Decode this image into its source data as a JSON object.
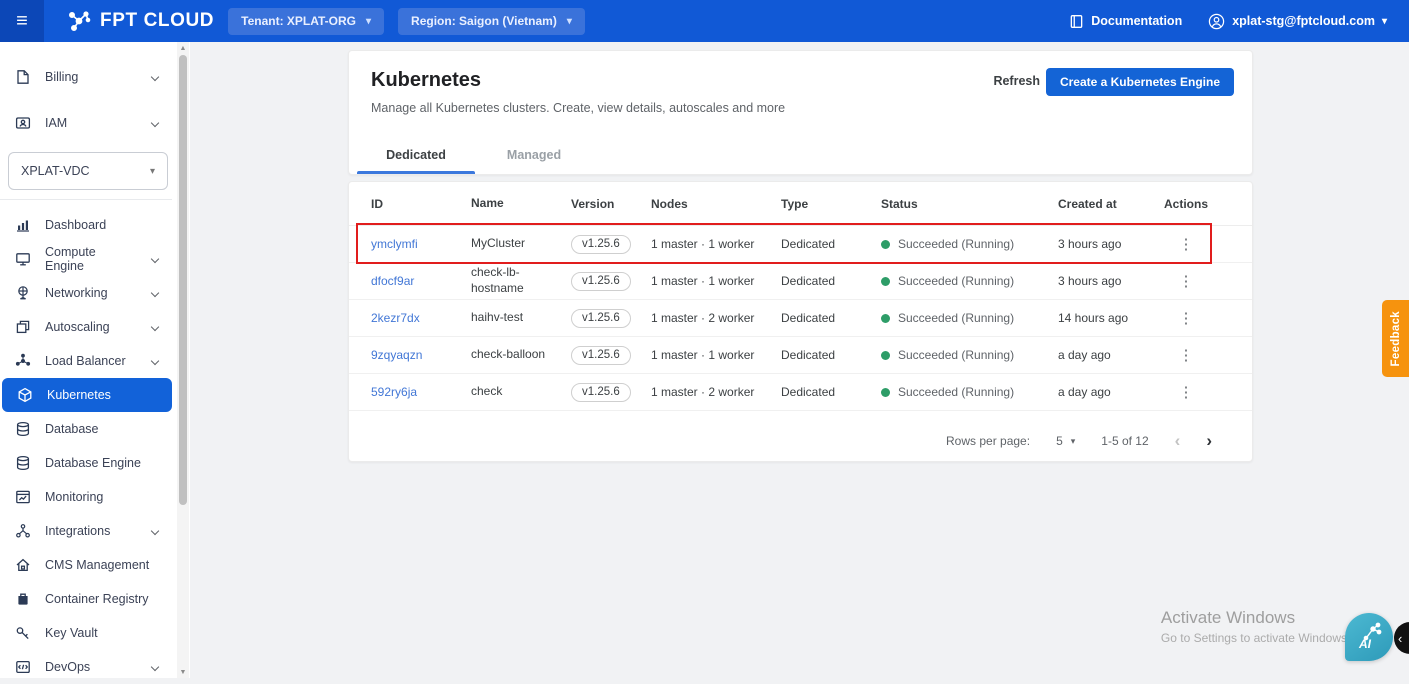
{
  "header": {
    "logo_text": "FPT CLOUD",
    "tenant_button": "Tenant: XPLAT-ORG",
    "region_button": "Region: Saigon (Vietnam)",
    "documentation_label": "Documentation",
    "user_email": "xplat-stg@fptcloud.com"
  },
  "icons": {
    "hamburger": "≡",
    "caret_down": "▾",
    "actions_kebab": "⋮",
    "pager_prev": "‹",
    "pager_next": "›",
    "scroll_up": "▲",
    "scroll_down": "▼",
    "edge_chevron": "‹",
    "ai_label": "AI"
  },
  "sidebar": {
    "top_items": [
      {
        "label": "Billing",
        "expandable": true
      },
      {
        "label": "IAM",
        "expandable": true
      }
    ],
    "vdc_selector_value": "XPLAT-VDC",
    "items": [
      {
        "label": "Dashboard",
        "expandable": false
      },
      {
        "label": "Compute Engine",
        "expandable": true
      },
      {
        "label": "Networking",
        "expandable": true
      },
      {
        "label": "Autoscaling",
        "expandable": true
      },
      {
        "label": "Load Balancer",
        "expandable": true
      },
      {
        "label": "Kubernetes",
        "expandable": false,
        "selected": true
      },
      {
        "label": "Database",
        "expandable": false
      },
      {
        "label": "Database Engine",
        "expandable": false
      },
      {
        "label": "Monitoring",
        "expandable": false
      },
      {
        "label": "Integrations",
        "expandable": true
      },
      {
        "label": "CMS Management",
        "expandable": false
      },
      {
        "label": "Container Registry",
        "expandable": false
      },
      {
        "label": "Key Vault",
        "expandable": false
      },
      {
        "label": "DevOps",
        "expandable": true
      }
    ]
  },
  "main": {
    "page_title": "Kubernetes",
    "page_subtitle": "Manage all Kubernetes clusters. Create, view details, autoscales and more",
    "refresh_label": "Refresh",
    "create_button_label": "Create a Kubernetes Engine",
    "tabs": [
      {
        "label": "Dedicated",
        "active": true
      },
      {
        "label": "Managed",
        "active": false
      }
    ],
    "table": {
      "columns": [
        "ID",
        "Name",
        "Version",
        "Nodes",
        "Type",
        "Status",
        "Created at",
        "Actions"
      ],
      "rows": [
        {
          "id": "ymclymfi",
          "name": "MyCluster",
          "version": "v1.25.6",
          "nodes": "1 master · 1 worker",
          "type": "Dedicated",
          "status": "Succeeded (Running)",
          "created": "3 hours ago",
          "highlighted": true
        },
        {
          "id": "dfocf9ar",
          "name": "check-lb-hostname",
          "version": "v1.25.6",
          "nodes": "1 master · 1 worker",
          "type": "Dedicated",
          "status": "Succeeded (Running)",
          "created": "3 hours ago",
          "highlighted": false
        },
        {
          "id": "2kezr7dx",
          "name": "haihv-test",
          "version": "v1.25.6",
          "nodes": "1 master · 2 worker",
          "type": "Dedicated",
          "status": "Succeeded (Running)",
          "created": "14 hours ago",
          "highlighted": false
        },
        {
          "id": "9zqyaqzn",
          "name": "check-balloon",
          "version": "v1.25.6",
          "nodes": "1 master · 1 worker",
          "type": "Dedicated",
          "status": "Succeeded (Running)",
          "created": "a day ago",
          "highlighted": false
        },
        {
          "id": "592ry6ja",
          "name": "check",
          "version": "v1.25.6",
          "nodes": "1 master · 2 worker",
          "type": "Dedicated",
          "status": "Succeeded (Running)",
          "created": "a day ago",
          "highlighted": false
        }
      ],
      "pagination": {
        "rows_per_page_label": "Rows per page:",
        "rows_per_page_value": "5",
        "range_label": "1-5 of 12"
      }
    }
  },
  "feedback_label": "Feedback",
  "watermark": {
    "line1": "Activate Windows",
    "line2": "Go to Settings to activate Windows"
  },
  "colors": {
    "header_blue": "#1159d6",
    "accent_blue": "#1464d6",
    "selected_blue": "#1262d9",
    "status_green": "#2e9d68",
    "highlight_red": "#e11d1d",
    "feedback_orange": "#f6930e"
  }
}
